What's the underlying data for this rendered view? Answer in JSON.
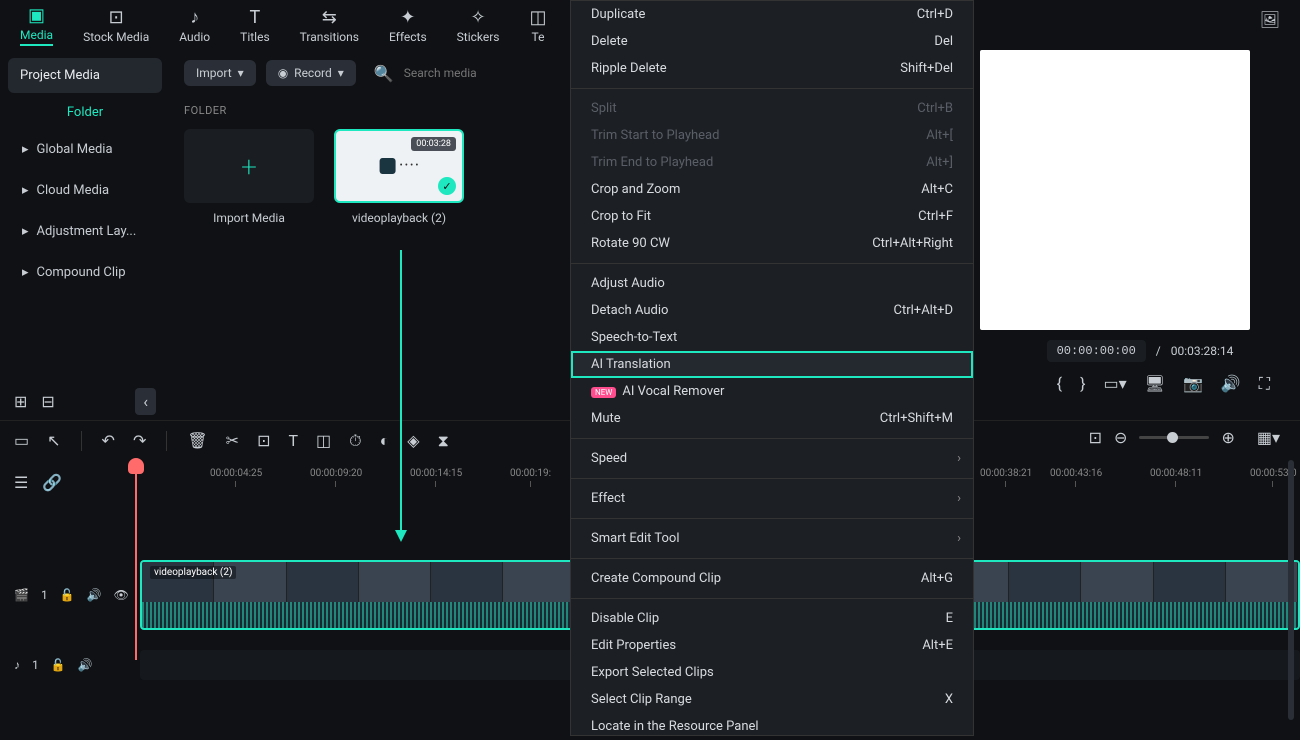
{
  "tabs": {
    "media": "Media",
    "stock": "Stock Media",
    "audio": "Audio",
    "titles": "Titles",
    "transitions": "Transitions",
    "effects": "Effects",
    "stickers": "Stickers",
    "templates": "Te"
  },
  "sidebar": {
    "project_media": "Project Media",
    "folder": "Folder",
    "items": [
      "Global Media",
      "Cloud Media",
      "Adjustment Lay...",
      "Compound Clip"
    ]
  },
  "toolbar": {
    "import": "Import",
    "record": "Record",
    "search_ph": "Search media"
  },
  "folder_header": "FOLDER",
  "tiles": {
    "import": "Import Media",
    "clip_name": "videoplayback (2)",
    "clip_dur": "00:03:28"
  },
  "ctx": [
    {
      "label": "Duplicate",
      "sc": "Ctrl+D"
    },
    {
      "label": "Delete",
      "sc": "Del"
    },
    {
      "label": "Ripple Delete",
      "sc": "Shift+Del"
    },
    {
      "sep": true
    },
    {
      "label": "Split",
      "sc": "Ctrl+B",
      "dis": true
    },
    {
      "label": "Trim Start to Playhead",
      "sc": "Alt+[",
      "dis": true
    },
    {
      "label": "Trim End to Playhead",
      "sc": "Alt+]",
      "dis": true
    },
    {
      "label": "Crop and Zoom",
      "sc": "Alt+C"
    },
    {
      "label": "Crop to Fit",
      "sc": "Ctrl+F"
    },
    {
      "label": "Rotate 90 CW",
      "sc": "Ctrl+Alt+Right"
    },
    {
      "sep": true
    },
    {
      "label": "Adjust Audio"
    },
    {
      "label": "Detach Audio",
      "sc": "Ctrl+Alt+D"
    },
    {
      "label": "Speech-to-Text"
    },
    {
      "label": "AI Translation",
      "hl": true
    },
    {
      "label": "AI Vocal Remover",
      "new": true
    },
    {
      "label": "Mute",
      "sc": "Ctrl+Shift+M"
    },
    {
      "sep": true
    },
    {
      "label": "Speed",
      "sub": true
    },
    {
      "sep": true
    },
    {
      "label": "Effect",
      "sub": true
    },
    {
      "sep": true
    },
    {
      "label": "Smart Edit Tool",
      "sub": true
    },
    {
      "sep": true
    },
    {
      "label": "Create Compound Clip",
      "sc": "Alt+G"
    },
    {
      "sep": true
    },
    {
      "label": "Disable Clip",
      "sc": "E"
    },
    {
      "label": "Edit Properties",
      "sc": "Alt+E"
    },
    {
      "label": "Export Selected Clips"
    },
    {
      "label": "Select Clip Range",
      "sc": "X"
    },
    {
      "label": "Locate in the Resource Panel"
    }
  ],
  "preview": {
    "current": "00:00:00:00",
    "sep": "/",
    "total": "00:03:28:14"
  },
  "ruler": [
    "00:00:04:25",
    "00:00:09:20",
    "00:00:14:15",
    "00:00:19:",
    "00:00:38:21",
    "00:00:43:16",
    "00:00:48:11",
    "00:00:53:0"
  ],
  "ruler_pos": [
    210,
    310,
    410,
    510,
    980,
    1050,
    1150,
    1250
  ],
  "track": {
    "video": "1",
    "audio": "1"
  },
  "clip_tl": "videoplayback (2)"
}
